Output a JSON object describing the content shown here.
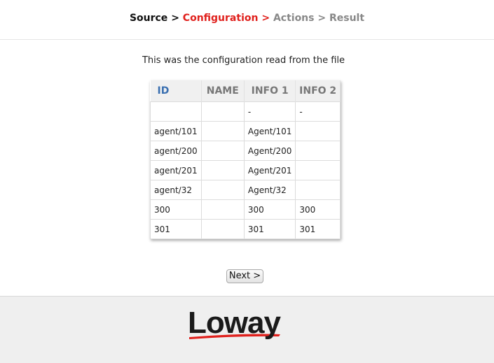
{
  "breadcrumb": {
    "steps": [
      "Source",
      "Configuration",
      "Actions",
      "Result"
    ],
    "separator": ">"
  },
  "intro_text": "This was the configuration read from the file",
  "table": {
    "headers": [
      "ID",
      "NAME",
      "INFO 1",
      "INFO 2"
    ],
    "rows": [
      [
        "",
        "",
        "-",
        "-"
      ],
      [
        "agent/101",
        "",
        "Agent/101",
        ""
      ],
      [
        "agent/200",
        "",
        "Agent/200",
        ""
      ],
      [
        "agent/201",
        "",
        "Agent/201",
        ""
      ],
      [
        "agent/32",
        "",
        "Agent/32",
        ""
      ],
      [
        "300",
        "",
        "300",
        "300"
      ],
      [
        "301",
        "",
        "301",
        "301"
      ]
    ]
  },
  "next_button": "Next >",
  "footer": {
    "logo_text": "Loway"
  },
  "colors": {
    "current_step": "#e0201c",
    "future_step": "#888888",
    "id_header": "#3a6fb0",
    "footer_bg": "#efefef"
  }
}
